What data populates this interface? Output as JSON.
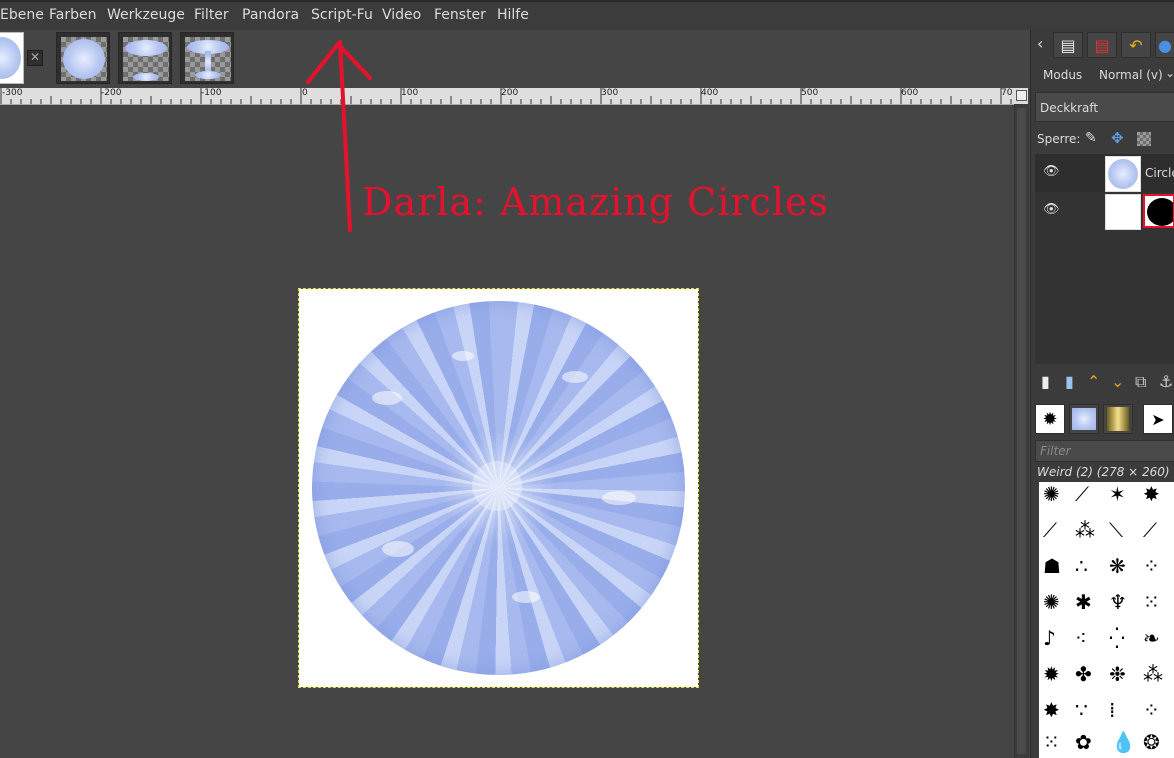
{
  "menubar": {
    "items": [
      "Ebene",
      "Farben",
      "Werkzeuge",
      "Filter",
      "Pandora",
      "Script-Fu",
      "Video",
      "Fenster",
      "Hilfe"
    ]
  },
  "ruler": {
    "labels": [
      "-300",
      "-200",
      "-100",
      "0",
      "100",
      "200",
      "300",
      "400",
      "500",
      "600",
      "70"
    ]
  },
  "annotation": {
    "text": "Darla: Amazing Circles",
    "color": "#e8112d"
  },
  "image_tabs": [
    {
      "name": "image-tab-active",
      "kind": "circle-white"
    },
    {
      "name": "image-tab-circle",
      "kind": "circle-checker"
    },
    {
      "name": "image-tab-ellipses",
      "kind": "ellipses-checker"
    },
    {
      "name": "image-tab-pedestal",
      "kind": "pedestal-checker"
    }
  ],
  "dock": {
    "mode_label": "Modus",
    "mode_value": "Normal (v)",
    "opacity_label": "Deckkraft",
    "lock_label": "Sperre:",
    "layers": [
      {
        "name": "Circle",
        "visible": true
      },
      {
        "name": "",
        "visible": true
      }
    ],
    "brush_filter_placeholder": "Filter",
    "brush_info": "Weird (2) (278 × 260)"
  },
  "colors": {
    "background": "#454545",
    "menubar": "#3c3c3c",
    "canvas_border": "#e7e12a",
    "circle_blue": "#a7b9ee"
  }
}
